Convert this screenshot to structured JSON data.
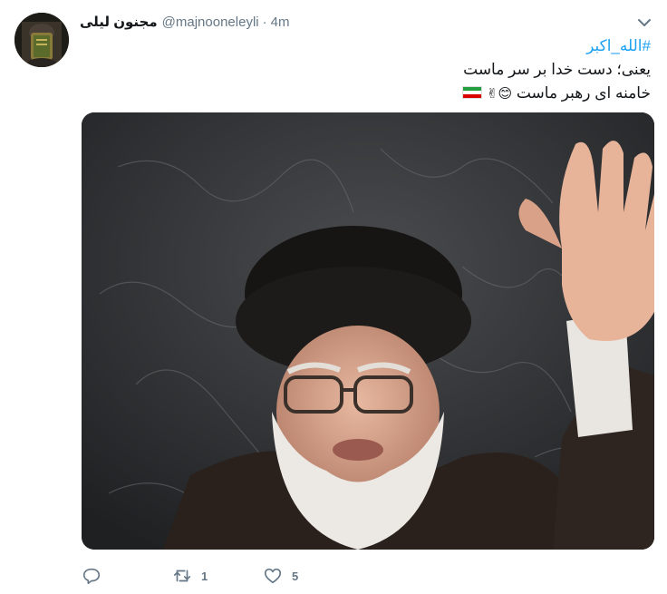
{
  "tweet": {
    "display_name": "مجنون لیلی",
    "handle": "@majnooneleyli",
    "separator": "·",
    "time": "4m",
    "hashtag": "#الله_اکبر",
    "line1": "یعنی؛ دست خدا بر سر ماست",
    "line2": "خامنه ای رهبر ماست",
    "line2_emojis": "😊✌",
    "flag_icon": "iran-flag-icon",
    "caret_icon": "chevron-down-icon"
  },
  "actions": {
    "reply": {
      "icon": "reply-icon",
      "count": ""
    },
    "retweet": {
      "icon": "retweet-icon",
      "count": "1"
    },
    "like": {
      "icon": "heart-icon",
      "count": "5"
    }
  },
  "colors": {
    "link": "#1da1f2",
    "secondary_text": "#657786",
    "primary_text": "#14171a"
  }
}
